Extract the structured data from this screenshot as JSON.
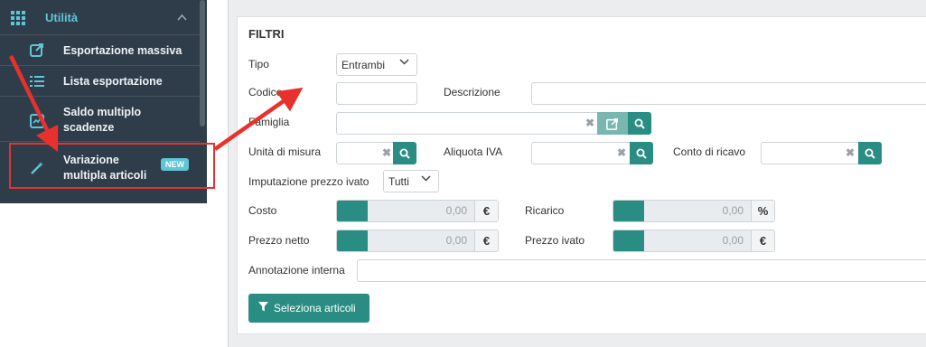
{
  "sidebar": {
    "section_title": "Utilità",
    "section_icon": "grid-icon",
    "items": [
      {
        "icon": "export-icon",
        "label": "Esportazione massiva"
      },
      {
        "icon": "list-icon",
        "label": "Lista esportazione"
      },
      {
        "icon": "chart-icon",
        "label": "Saldo multiplo scadenze"
      },
      {
        "icon": "magic-wand-icon",
        "label": "Variazione multipla articoli",
        "badge": "NEW"
      }
    ]
  },
  "filters": {
    "title": "FILTRI",
    "tipo_label": "Tipo",
    "tipo_value": "Entrambi",
    "codice_label": "Codice",
    "codice_value": "",
    "descrizione_label": "Descrizione",
    "descrizione_value": "",
    "famiglia_label": "Famiglia",
    "famiglia_value": "",
    "unita_label": "Unità di misura",
    "aliquota_label": "Aliquota IVA",
    "conto_label": "Conto di ricavo",
    "imputazione_label": "Imputazione prezzo ivato",
    "imputazione_value": "Tutti",
    "costo_label": "Costo",
    "costo_value": "0,00",
    "costo_unit": "€",
    "ricarico_label": "Ricarico",
    "ricarico_value": "0,00",
    "ricarico_unit": "%",
    "prezzo_netto_label": "Prezzo netto",
    "prezzo_netto_value": "0,00",
    "prezzo_netto_unit": "€",
    "prezzo_ivato_label": "Prezzo ivato",
    "prezzo_ivato_value": "0,00",
    "prezzo_ivato_unit": "€",
    "annotazione_label": "Annotazione interna",
    "annotazione_value": "",
    "clear_glyph": "✖",
    "submit_label": "Seleziona articoli"
  },
  "colors": {
    "sidebar_bg": "#2f3d4a",
    "accent": "#5fc6d6",
    "primary": "#2a8d84",
    "highlight": "#e2332f"
  }
}
